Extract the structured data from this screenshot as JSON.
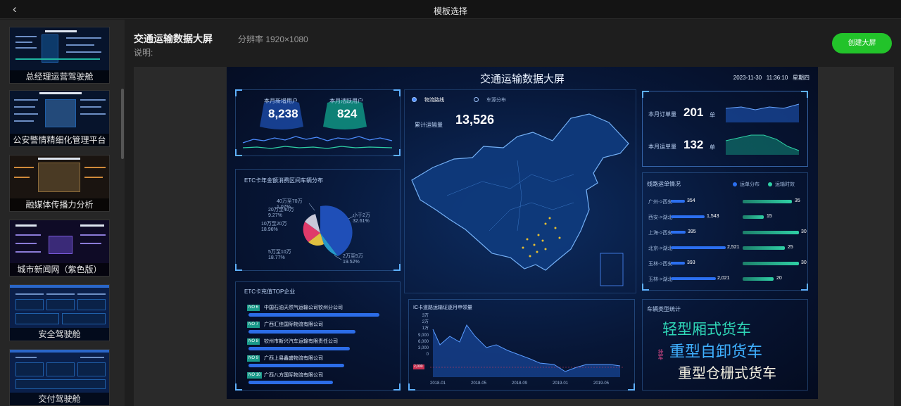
{
  "topbar": {
    "back_icon": "chevron-left-icon",
    "title": "模板选择"
  },
  "sidebar": {
    "templates": [
      {
        "label": "总经理运营驾驶舱"
      },
      {
        "label": "公安警情精细化管理平台"
      },
      {
        "label": "融媒体传播力分析"
      },
      {
        "label": "城市新闻网（紫色版）"
      },
      {
        "label": "安全驾驶舱"
      },
      {
        "label": "交付驾驶舱"
      }
    ]
  },
  "detail": {
    "name": "交通运输数据大屏",
    "resolution": "分辨率 1920×1080",
    "description": "说明:",
    "create_button": "创建大屏"
  },
  "dashboard": {
    "title": "交通运输数据大屏",
    "date": "2023-11-30",
    "time": "11:36:10",
    "weekday": "星期四",
    "new_users_label": "本月新增用户",
    "new_users": "8,238",
    "active_users_label": "本月活跃用户",
    "active_users": "824",
    "etc_title": "ETC卡年金额消费区间车辆分布",
    "pie_labels": [
      {
        "text": "40万至70万",
        "value": "1.07%"
      },
      {
        "text": "20万至40万",
        "value": "9.27%"
      },
      {
        "text": "10万至20万",
        "value": "18.96%"
      },
      {
        "text": "5万至10万",
        "value": "18.77%"
      },
      {
        "text": "小于2万",
        "value": "32.61%"
      },
      {
        "text": "2万至5万",
        "value": "19.52%"
      }
    ],
    "top_title": "ETC卡充值TOP企业",
    "top_companies": [
      {
        "rank": "NO 6",
        "name": "中国石油天然气运输公司钦州分公司"
      },
      {
        "rank": "NO 7",
        "name": "广西汇佳国际物流有限公司"
      },
      {
        "rank": "NO 8",
        "name": "钦州市新兴汽车运输有限责任公司"
      },
      {
        "rank": "NO 9",
        "name": "广西上易鑫盛物流有限公司"
      },
      {
        "rank": "NO 10",
        "name": "广西八方国际物流有限公司"
      }
    ],
    "map_tabs": [
      "物流路线",
      "车源分布"
    ],
    "freight_label": "累计运输量",
    "freight_value": "13,526",
    "orders_label": "本月订单量",
    "orders_value": "201",
    "orders_unit": "单",
    "shipments_label": "本月运单量",
    "shipments_value": "132",
    "shipments_unit": "单",
    "routes_title": "线路运单情况",
    "routes_legend": [
      "运单分布",
      "运输时效"
    ],
    "routes": [
      {
        "name": "广州->西安",
        "count": "354",
        "time": "35"
      },
      {
        "name": "西安->湖北",
        "count": "1,543",
        "time": "15"
      },
      {
        "name": "上海->西安",
        "count": "395",
        "time": "30"
      },
      {
        "name": "北京->湖北",
        "count": "2,521",
        "time": "25"
      },
      {
        "name": "玉林->西安",
        "count": "393",
        "time": "30"
      },
      {
        "name": "玉林->湖北",
        "count": "2,021",
        "time": "20"
      }
    ],
    "ic_title": "IC卡道路运输证逐月申领量",
    "ic_yticks": [
      "3万",
      "2万",
      "1万",
      "9,000",
      "6,000",
      "3,000",
      "0"
    ],
    "ic_marker": "2,000",
    "ic_xticks": [
      "2018-01",
      "2018-05",
      "2018-09",
      "2019-01",
      "2019-05"
    ],
    "vehicle_title": "车辆类型统计",
    "vehicle_types": [
      "轻型厢式货车",
      "重型自卸货车",
      "重型仓栅式货车"
    ],
    "vehicle_side": "挂车"
  },
  "colors": {
    "create": "#22c32a",
    "panel_blue": "#2b6ff0",
    "teal": "#2fd0a5"
  }
}
